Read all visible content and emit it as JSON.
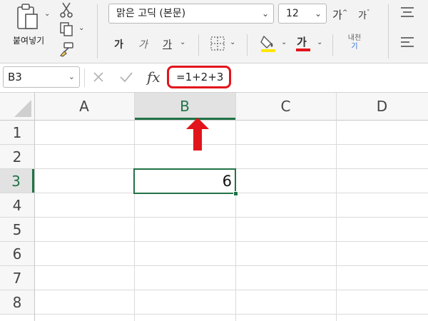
{
  "clipboard": {
    "paste_label": "붙여넣기"
  },
  "font": {
    "name": "맑은 고딕 (본문)",
    "size": "12",
    "grow_label": "가",
    "shrink_label": "가"
  },
  "format": {
    "bold_label": "가",
    "italic_label": "가",
    "underline_label": "가",
    "font_color_label": "가",
    "phonetic_label": "내천",
    "phonetic_sub": "기"
  },
  "namebox": {
    "value": "B3"
  },
  "formula_bar": {
    "fx_label": "fx",
    "formula": "=1+2+3"
  },
  "sheet": {
    "columns": [
      "A",
      "B",
      "C",
      "D"
    ],
    "rows": [
      "1",
      "2",
      "3",
      "4",
      "5",
      "6",
      "7",
      "8"
    ],
    "active_column": "B",
    "active_row": "3",
    "active_cell_value": "6"
  },
  "colors": {
    "accent_green": "#217346",
    "highlight_red": "#e2141b",
    "fill_yellow": "#ffe600"
  }
}
